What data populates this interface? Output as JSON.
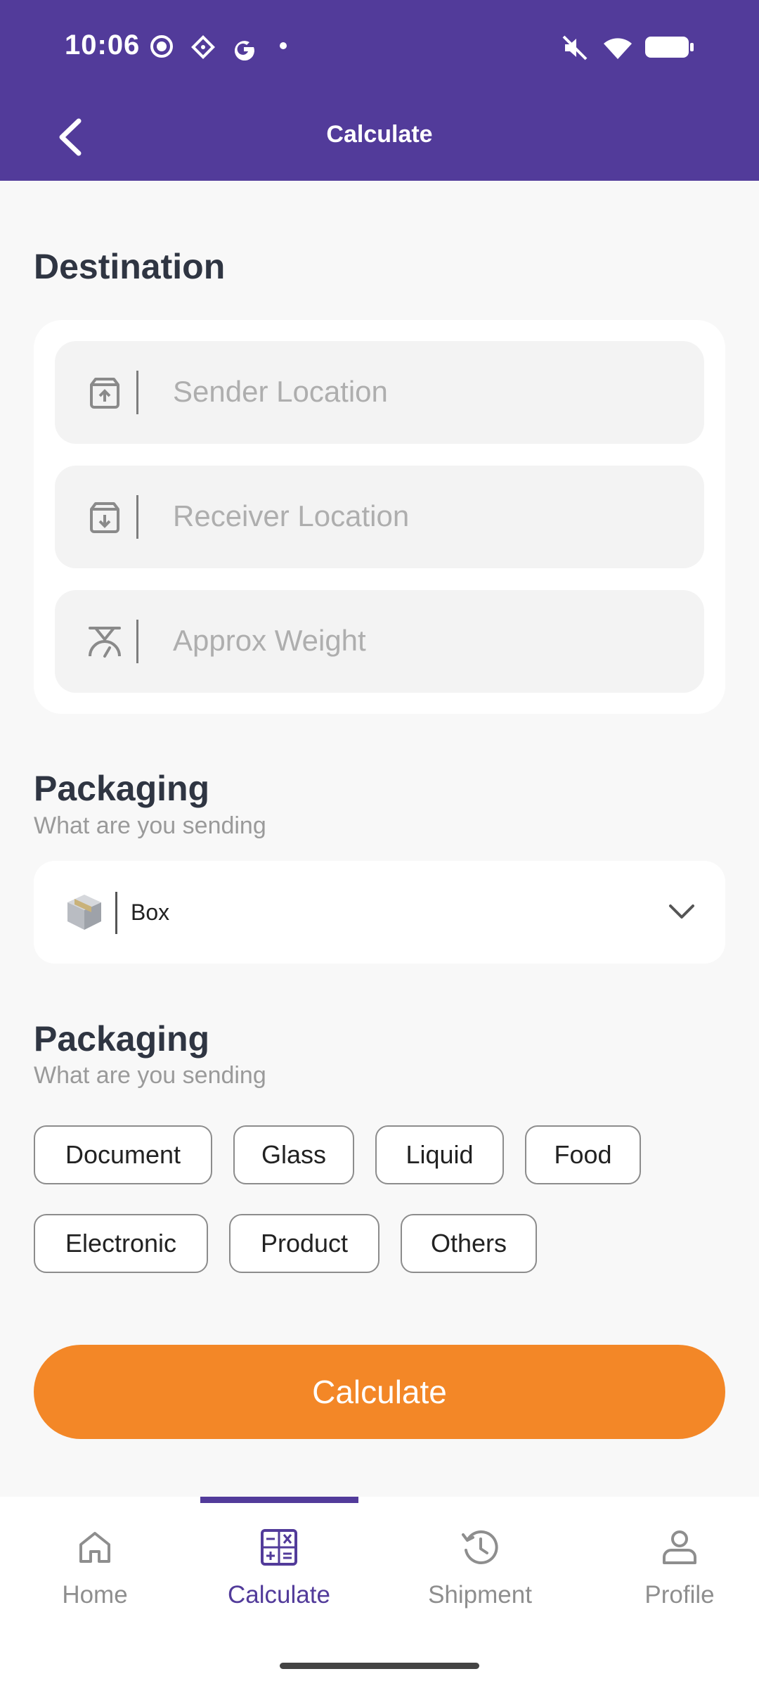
{
  "status_bar": {
    "time": "10:06"
  },
  "header": {
    "title": "Calculate"
  },
  "destination": {
    "heading": "Destination",
    "fields": [
      {
        "icon": "box-upload-icon",
        "placeholder": "Sender Location"
      },
      {
        "icon": "box-download-icon",
        "placeholder": "Receiver Location"
      },
      {
        "icon": "scale-icon",
        "placeholder": "Approx Weight"
      }
    ]
  },
  "packaging": {
    "heading": "Packaging",
    "subtitle": "What are you sending",
    "selected": "Box",
    "icon": "package-box-icon"
  },
  "categories": {
    "heading": "Packaging",
    "subtitle": "What are you sending",
    "chips": [
      "Document",
      "Glass",
      "Liquid",
      "Food",
      "Electronic",
      "Product",
      "Others"
    ]
  },
  "cta": {
    "label": "Calculate",
    "color": "#f38727"
  },
  "bottom_nav": {
    "items": [
      {
        "label": "Home",
        "icon": "home-icon"
      },
      {
        "label": "Calculate",
        "icon": "calculator-icon",
        "active": true
      },
      {
        "label": "Shipment",
        "icon": "history-icon"
      },
      {
        "label": "Profile",
        "icon": "profile-icon"
      }
    ]
  },
  "colors": {
    "primary": "#523b9a",
    "accent": "#f38727",
    "background": "#f8f8f8"
  }
}
